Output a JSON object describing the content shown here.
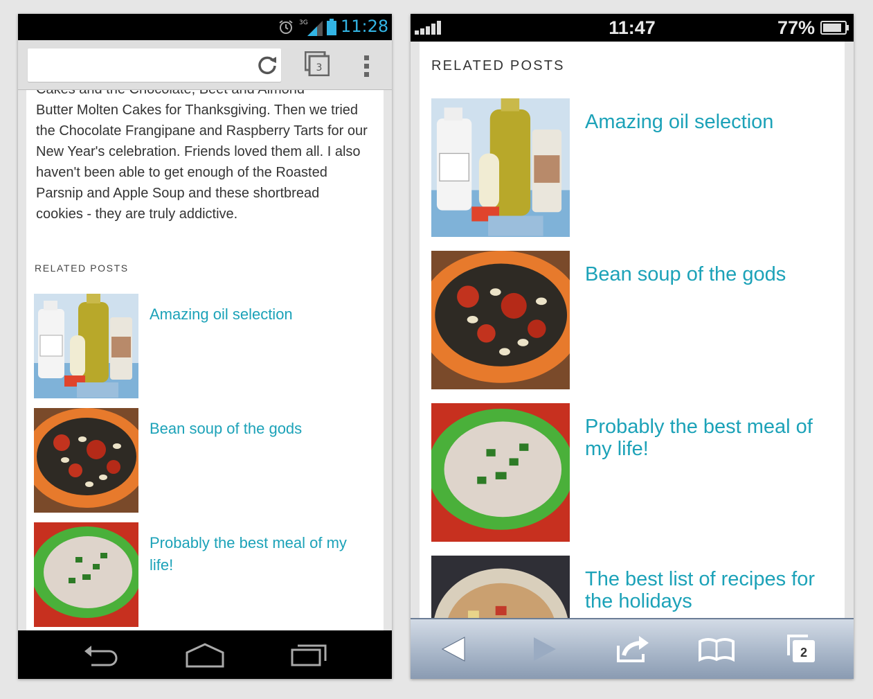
{
  "android": {
    "status": {
      "time": "11:28",
      "network": "3G",
      "accent": "#33b5e5"
    },
    "toolbar": {
      "url": "",
      "tab_count": "3"
    },
    "article": {
      "cut_line": "Cakes and the Chocolate, Beet and Almond",
      "body": "Butter Molten Cakes for Thanksgiving. Then we tried the Chocolate Frangipane and Raspberry Tarts for our New Year's celebration. Friends loved them all. I also haven't been able to get enough of the Roasted Parsnip and Apple Soup and these shortbread cookies - they are truly addictive."
    },
    "related": {
      "heading": "RELATED POSTS",
      "posts": [
        {
          "title": "Amazing oil selection"
        },
        {
          "title": "Bean soup of the gods"
        },
        {
          "title": "Probably the best meal of my life!"
        }
      ]
    },
    "nav": {
      "icons": [
        "back-icon",
        "home-icon",
        "recent-apps-icon"
      ]
    }
  },
  "iphone": {
    "status": {
      "time": "11:47",
      "battery": "77%"
    },
    "related": {
      "heading": "RELATED POSTS",
      "posts": [
        {
          "title": "Amazing oil selection"
        },
        {
          "title": "Bean soup of the gods"
        },
        {
          "title": "Probably the best meal of my life!"
        },
        {
          "title": "The best list of recipes for the holidays"
        }
      ]
    },
    "toolbar": {
      "tab_count": "2",
      "icons": [
        "back-icon",
        "forward-icon",
        "share-icon",
        "bookmarks-icon",
        "tabs-icon"
      ]
    }
  },
  "colors": {
    "link": "#1ca2b8",
    "text": "#333333"
  }
}
